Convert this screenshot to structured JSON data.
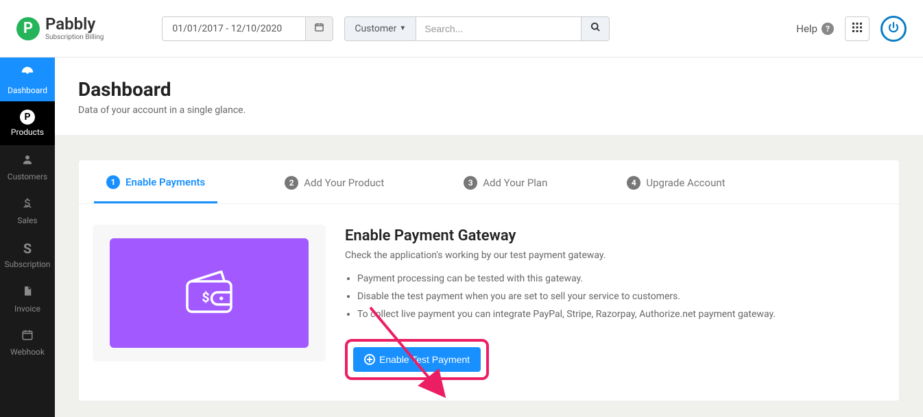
{
  "brand": {
    "name": "Pabbly",
    "subtitle": "Subscription Billing"
  },
  "topbar": {
    "date_range": "01/01/2017 - 12/10/2020",
    "customer_label": "Customer",
    "search_placeholder": "Search...",
    "help_label": "Help"
  },
  "sidebar": {
    "items": [
      {
        "label": "Dashboard"
      },
      {
        "label": "Products"
      },
      {
        "label": "Customers"
      },
      {
        "label": "Sales"
      },
      {
        "label": "Subscription"
      },
      {
        "label": "Invoice"
      },
      {
        "label": "Webhook"
      }
    ]
  },
  "page": {
    "title": "Dashboard",
    "subtitle": "Data of your account in a single glance."
  },
  "tabs": [
    {
      "num": "1",
      "label": "Enable Payments"
    },
    {
      "num": "2",
      "label": "Add Your Product"
    },
    {
      "num": "3",
      "label": "Add Your Plan"
    },
    {
      "num": "4",
      "label": "Upgrade Account"
    }
  ],
  "panel": {
    "heading": "Enable Payment Gateway",
    "lead": "Check the application's working by our test payment gateway.",
    "bullets": [
      "Payment processing can be tested with this gateway.",
      "Disable the test payment when you are set to sell your service to customers.",
      "To collect live payment you can integrate PayPal, Stripe, Razorpay, Authorize.net payment gateway."
    ],
    "button_label": "Enable Test Payment"
  },
  "colors": {
    "primary": "#1890ff",
    "accent": "#a259ff",
    "highlight": "#eb1e63",
    "brand_green": "#25b45a"
  }
}
